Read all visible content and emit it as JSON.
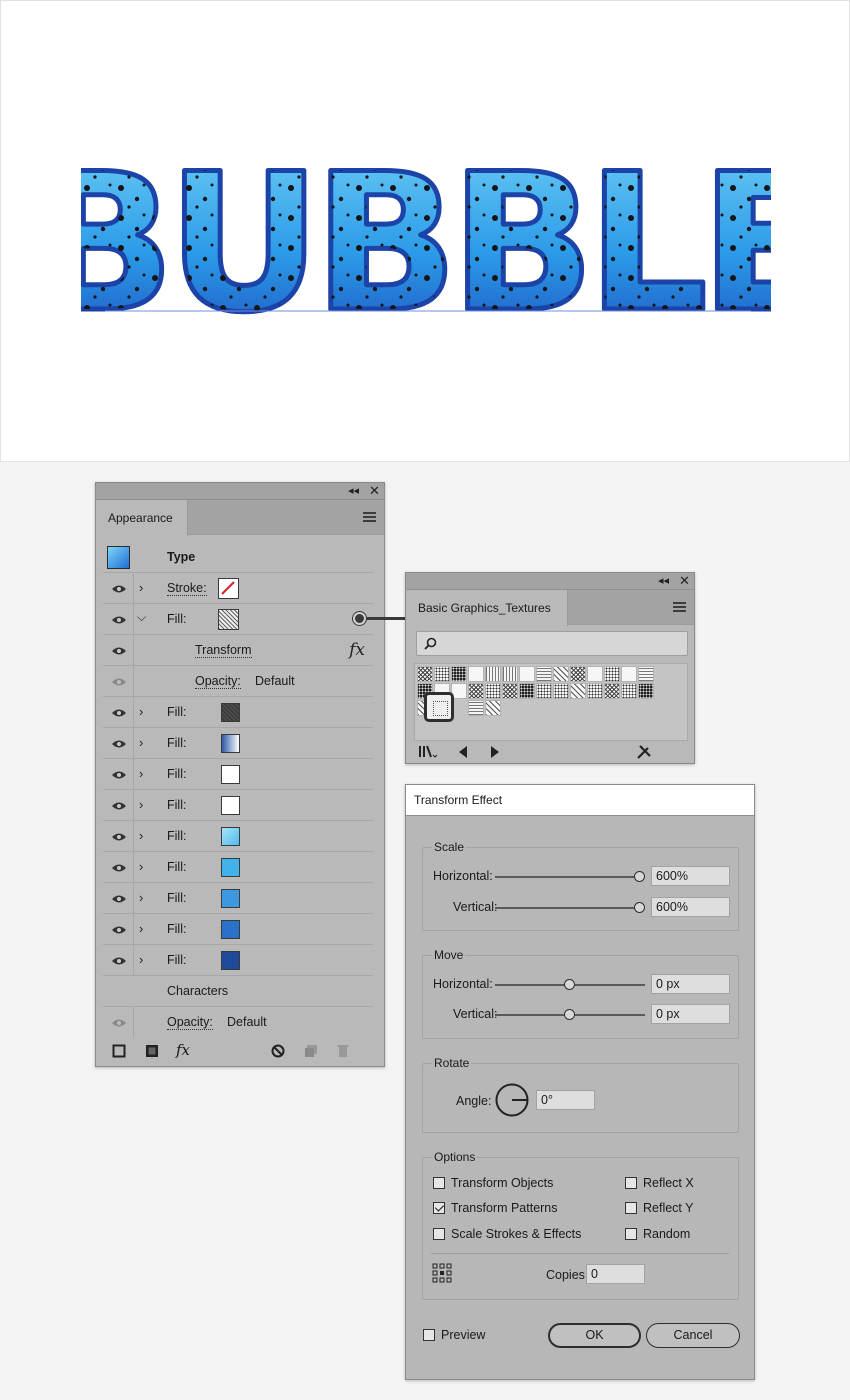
{
  "canvas": {
    "artwork_text": "BUBBLE",
    "colors": {
      "light": "#7fd8f8",
      "mid": "#2ea0ee",
      "dark": "#1d4fbf",
      "dots": "#151515",
      "baseline": "#6f8fe0"
    }
  },
  "appearance": {
    "tab": "Appearance",
    "type_label": "Type",
    "rows": [
      {
        "label": "Stroke:",
        "swatch": "none-red-slash"
      },
      {
        "label": "Fill:",
        "swatch": "texture-pattern",
        "expanded": true
      },
      {
        "label": "Transform",
        "fx": "fx"
      },
      {
        "label": "Opacity:",
        "value": "Default"
      },
      {
        "label": "Fill:",
        "swatch": "#3a3a3a"
      },
      {
        "label": "Fill:",
        "swatch": "#4a7ac8"
      },
      {
        "label": "Fill:",
        "swatch": "#ffffff"
      },
      {
        "label": "Fill:",
        "swatch": "#ffffff"
      },
      {
        "label": "Fill:",
        "swatch": "#7dd1f2"
      },
      {
        "label": "Fill:",
        "swatch": "#41b3ea"
      },
      {
        "label": "Fill:",
        "swatch": "#3e98e0"
      },
      {
        "label": "Fill:",
        "swatch": "#2a72c9"
      },
      {
        "label": "Fill:",
        "swatch": "#1e4a9a"
      }
    ],
    "characters_label": "Characters",
    "bottom_opacity_label": "Opacity:",
    "bottom_opacity_value": "Default",
    "footer_fx": "fx"
  },
  "textures_panel": {
    "tab": "Basic Graphics_Textures",
    "search_placeholder": ""
  },
  "transform": {
    "title": "Transform Effect",
    "scale": {
      "title": "Scale",
      "horizontal_label": "Horizontal:",
      "horizontal_value": "600%",
      "vertical_label": "Vertical:",
      "vertical_value": "600%",
      "h_slider": 1.0,
      "v_slider": 1.0
    },
    "move": {
      "title": "Move",
      "horizontal_label": "Horizontal:",
      "horizontal_value": "0 px",
      "vertical_label": "Vertical:",
      "vertical_value": "0 px",
      "h_slider": 0.5,
      "v_slider": 0.5
    },
    "rotate": {
      "title": "Rotate",
      "angle_label": "Angle:",
      "angle_value": "0°"
    },
    "options": {
      "title": "Options",
      "transform_objects": {
        "label": "Transform Objects",
        "checked": false
      },
      "transform_patterns": {
        "label": "Transform Patterns",
        "checked": true
      },
      "scale_strokes": {
        "label": "Scale Strokes & Effects",
        "checked": false
      },
      "reflect_x": {
        "label": "Reflect X",
        "checked": false
      },
      "reflect_y": {
        "label": "Reflect Y",
        "checked": false
      },
      "random": {
        "label": "Random",
        "checked": false
      },
      "copies_label": "Copies",
      "copies_value": "0"
    },
    "preview": {
      "label": "Preview",
      "checked": false
    },
    "ok_label": "OK",
    "cancel_label": "Cancel"
  }
}
